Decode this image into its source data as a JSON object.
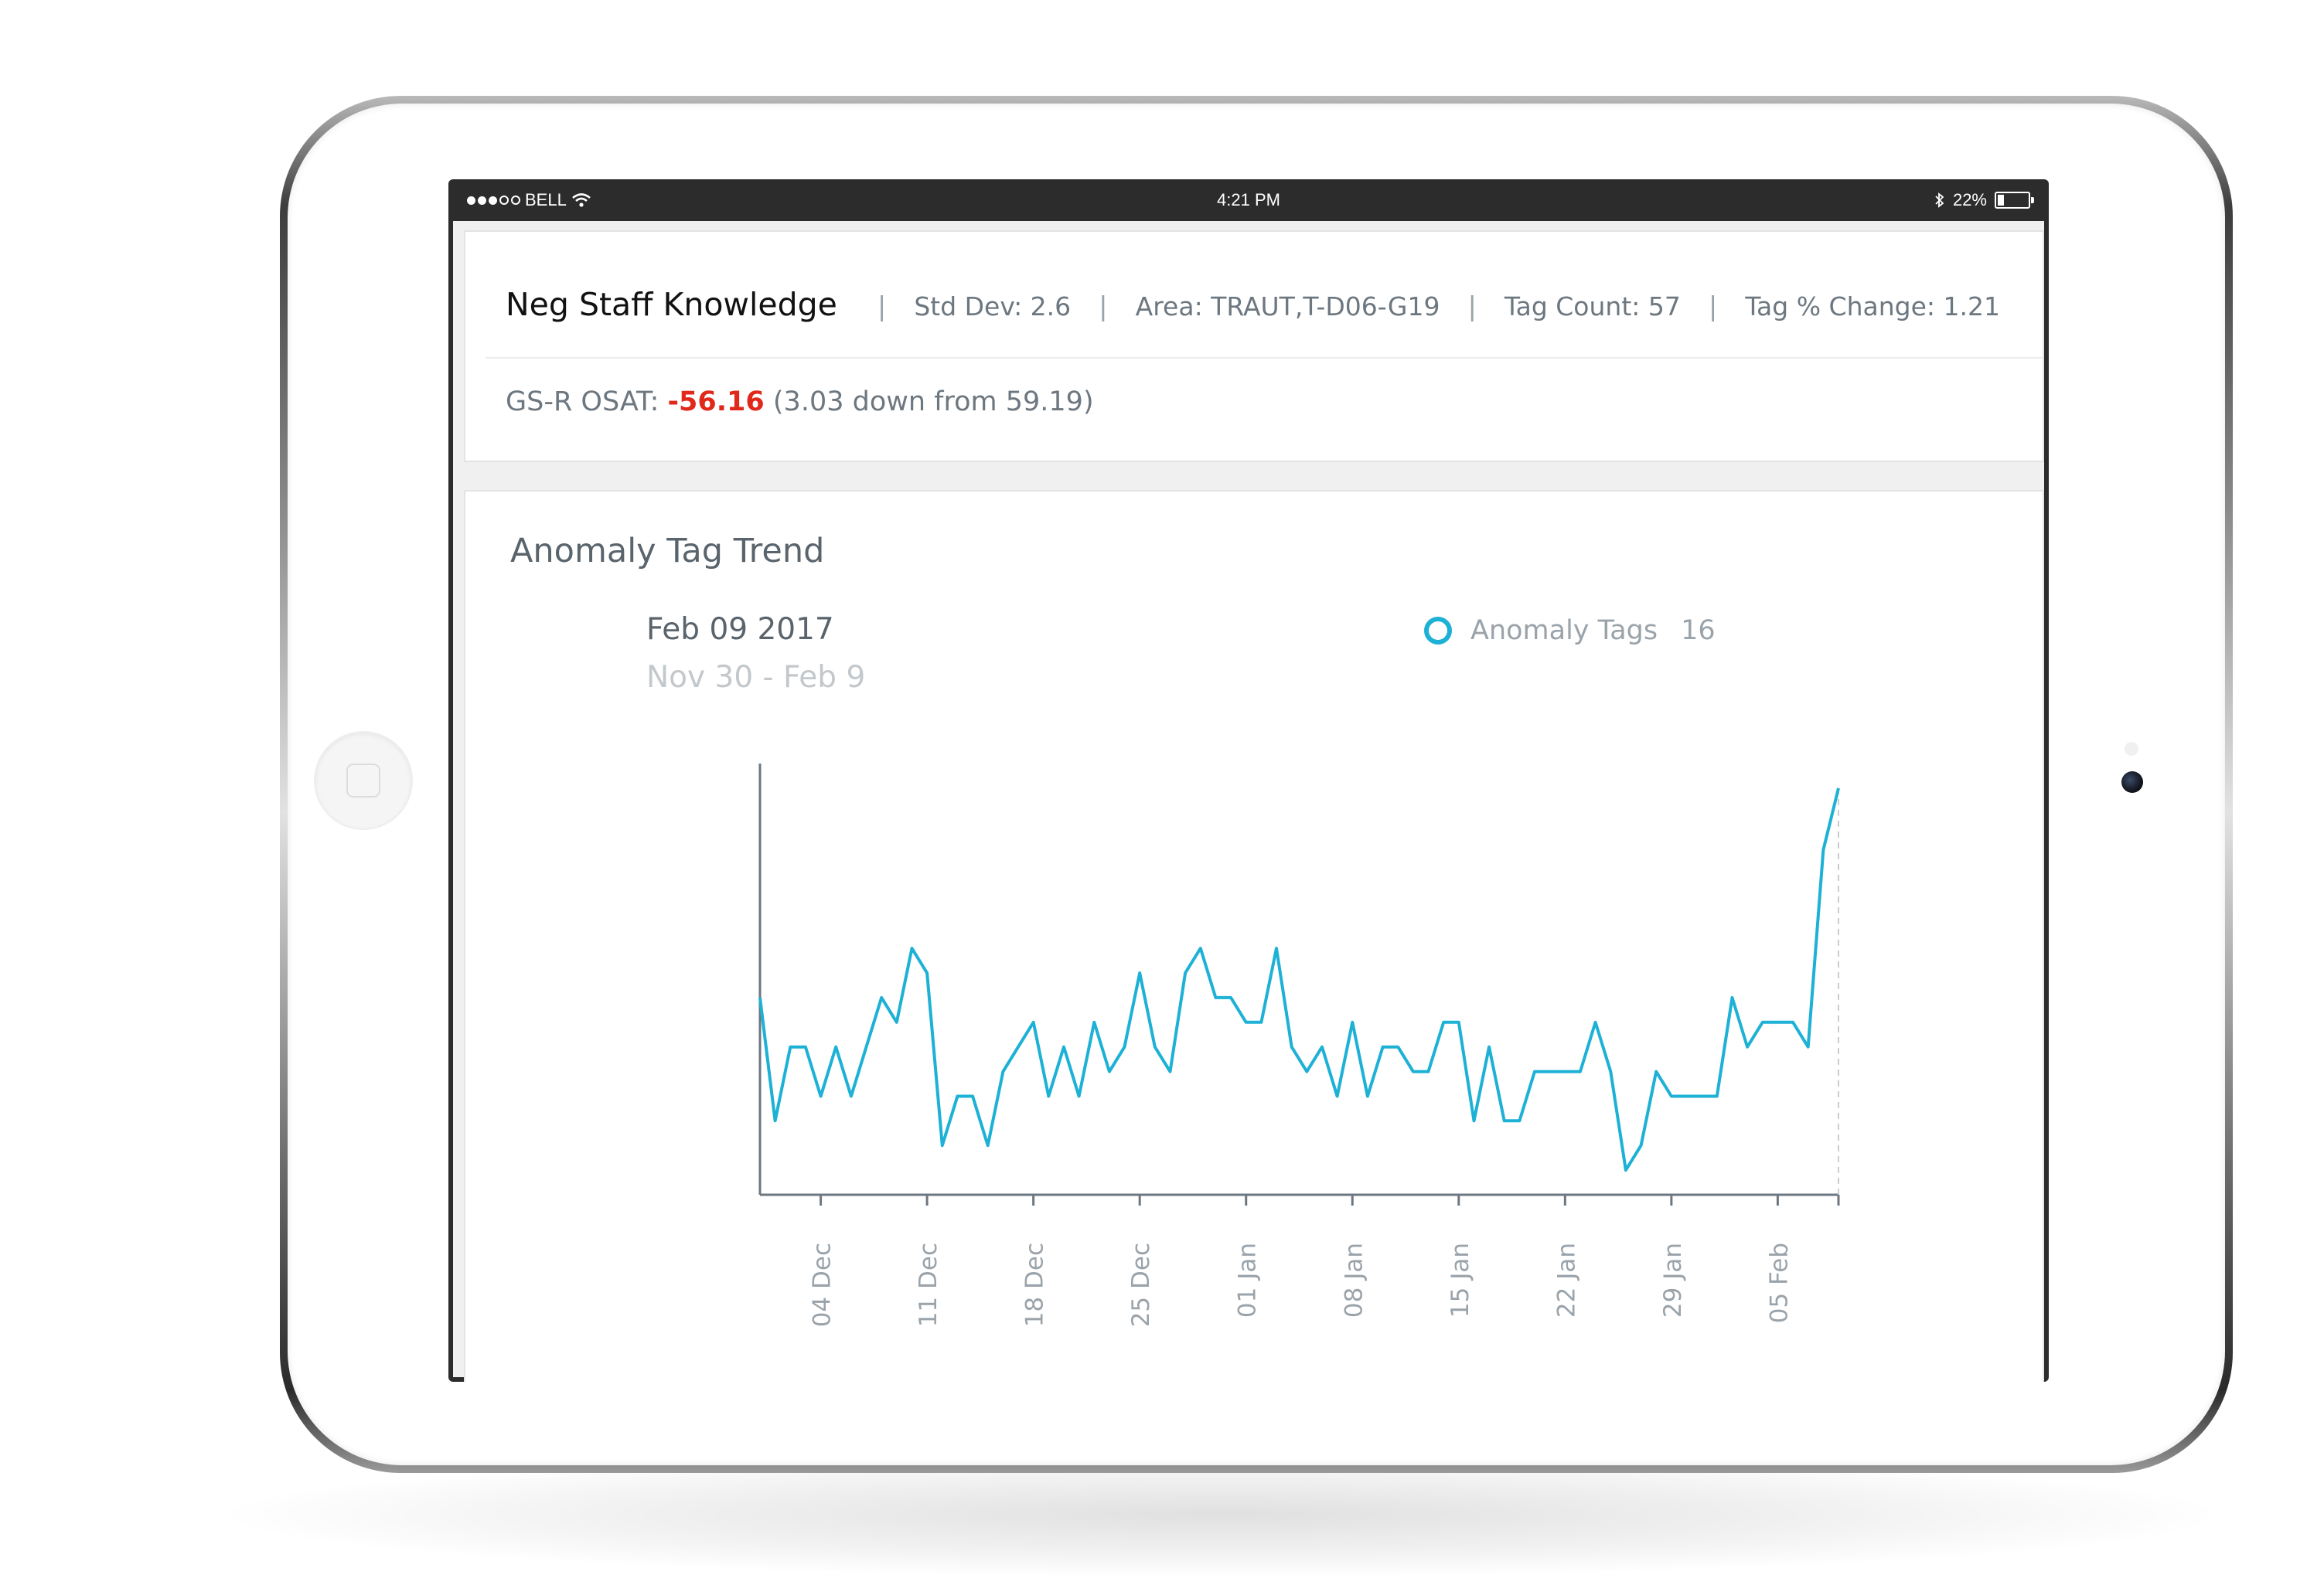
{
  "status_bar": {
    "carrier": "BELL",
    "time": "4:21 PM",
    "battery": "22%",
    "battery_level": 0.22,
    "icons": [
      "signal-dots",
      "wifi-icon",
      "bluetooth-icon",
      "battery-icon"
    ]
  },
  "header": {
    "title": "Neg Staff Knowledge",
    "std_dev": "Std Dev: 2.6",
    "area": "Area: TRAUT,T-D06-G19",
    "tag_count": "Tag Count: 57",
    "tag_change": "Tag % Change: 1.21",
    "osat_label": "GS-R OSAT:",
    "osat_value": "-56.16",
    "osat_detail": "(3.03 down from 59.19)"
  },
  "chart_section": {
    "title": "Anomaly Tag Trend",
    "date": "Feb 09 2017",
    "range": "Nov 30 - Feb 9",
    "legend_label": "Anomaly Tags",
    "legend_value": "16"
  },
  "colors": {
    "accent": "#1db1d6",
    "negative": "#e0281b",
    "text": "#6d7780",
    "title": "#111111"
  },
  "chart_data": {
    "type": "line",
    "title": "Anomaly Tag Trend",
    "xlabel": "",
    "ylabel": "",
    "start_date": "2016-11-30",
    "tick_labels": [
      "04 Dec",
      "11 Dec",
      "18 Dec",
      "25 Dec",
      "01 Jan",
      "08 Jan",
      "15 Jan",
      "22 Jan",
      "29 Jan",
      "05 Feb"
    ],
    "tick_offsets": [
      4,
      11,
      18,
      25,
      32,
      39,
      46,
      53,
      60,
      67
    ],
    "x_range": [
      0,
      71
    ],
    "ylim": [
      0,
      17.5
    ],
    "grid": false,
    "legend": "top-right",
    "series": [
      {
        "name": "Anomaly Tags",
        "values": [
          8,
          3,
          6,
          6,
          4,
          6,
          4,
          6,
          8,
          7,
          10,
          9,
          2,
          4,
          4,
          2,
          5,
          6,
          7,
          4,
          6,
          4,
          7,
          5,
          6,
          9,
          6,
          5,
          9,
          10,
          8,
          8,
          7,
          7,
          10,
          6,
          5,
          6,
          4,
          7,
          4,
          6,
          6,
          5,
          5,
          7,
          7,
          3,
          6,
          3,
          3,
          5,
          5,
          5,
          5,
          7,
          5,
          1,
          2,
          5,
          4,
          4,
          4,
          4,
          8,
          6,
          7,
          7,
          7,
          6,
          14,
          16.5
        ]
      }
    ]
  }
}
